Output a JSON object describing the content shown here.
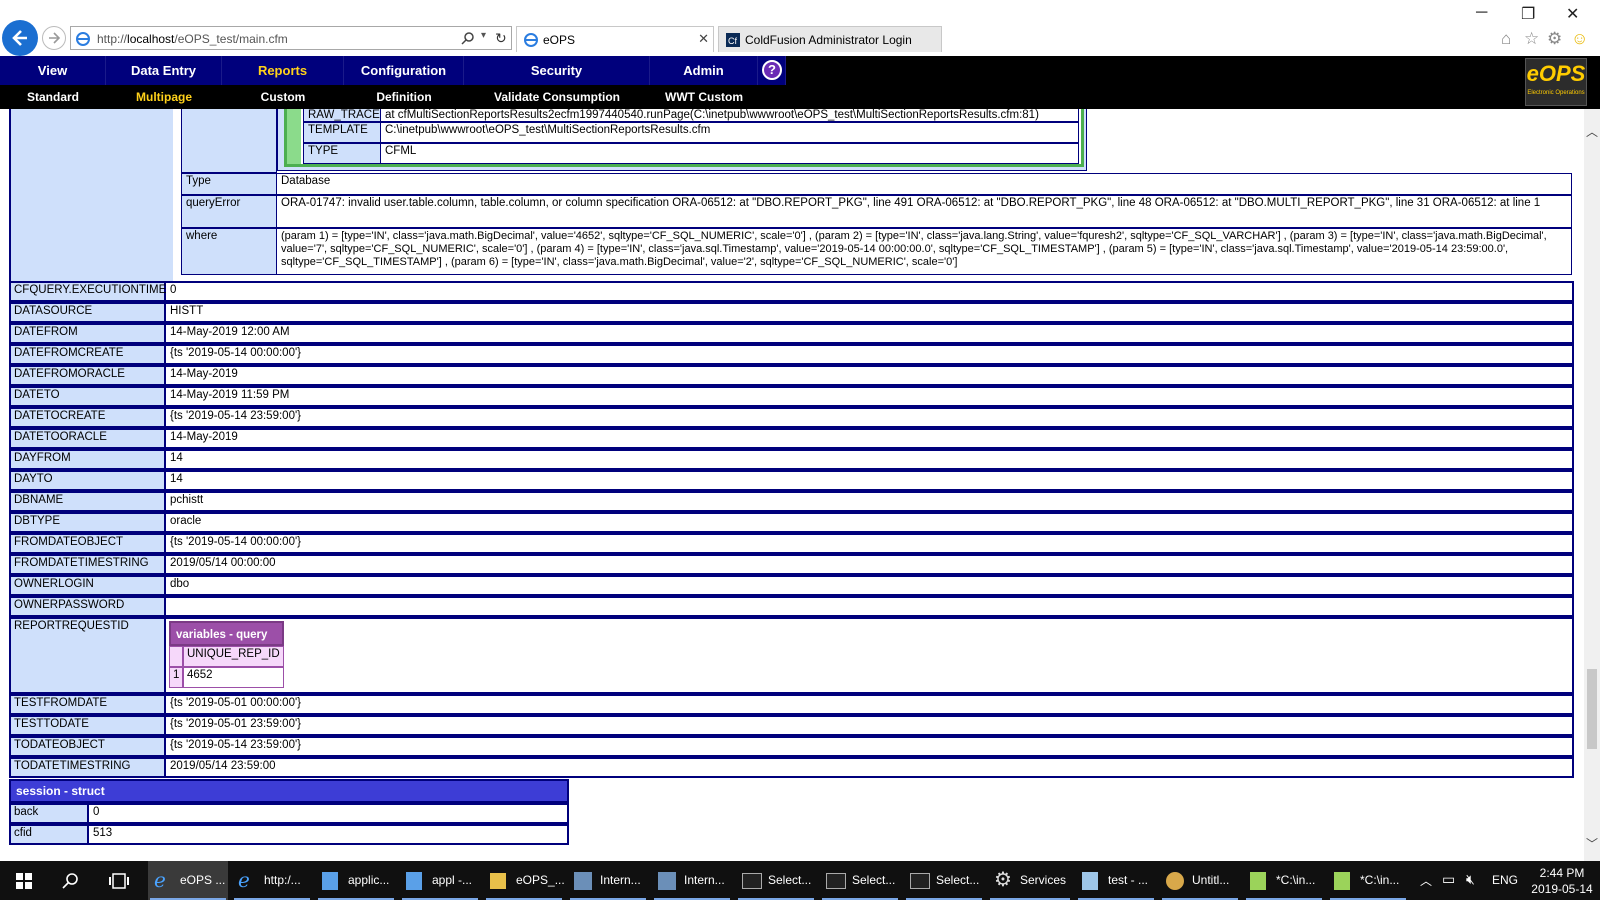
{
  "browser": {
    "url_prefix": "http://",
    "url_host": "localhost",
    "url_path": "/eOPS_test/main.cfm",
    "tabs": [
      {
        "label": "eOPS"
      },
      {
        "label": "ColdFusion Administrator Login"
      }
    ]
  },
  "nav": {
    "top": [
      "View",
      "Data Entry",
      "Reports",
      "Configuration",
      "Security",
      "Admin"
    ],
    "sub": [
      "Standard",
      "Multipage",
      "Custom",
      "Definition",
      "Validate Consumption",
      "WWT Custom"
    ],
    "help": "?",
    "logo": "eOPS",
    "logo_sub": "Electronic Operations"
  },
  "error": {
    "trace_rows": [
      {
        "key": "RAW_TRACE",
        "value": "at cfMultiSectionReportsResults2ecfm1997440540.runPage(C:\\inetpub\\wwwroot\\eOPS_test\\MultiSectionReportsResults.cfm:81)"
      },
      {
        "key": "TEMPLATE",
        "value": "C:\\inetpub\\wwwroot\\eOPS_test\\MultiSectionReportsResults.cfm"
      },
      {
        "key": "TYPE",
        "value": "CFML"
      }
    ],
    "type_key": "Type",
    "type_value": "Database",
    "queryerror_key": "queryError",
    "queryerror_value": "ORA-01747: invalid user.table.column, table.column, or column specification ORA-06512: at \"DBO.REPORT_PKG\", line 491 ORA-06512: at \"DBO.REPORT_PKG\", line 48 ORA-06512: at \"DBO.MULTI_REPORT_PKG\", line 31 ORA-06512: at line 1",
    "where_key": "where",
    "where_value": "(param 1) = [type='IN', class='java.math.BigDecimal', value='4652', sqltype='CF_SQL_NUMERIC', scale='0'] , (param 2) = [type='IN', class='java.lang.String', value='fquresh2', sqltype='CF_SQL_VARCHAR'] , (param 3) = [type='IN', class='java.math.BigDecimal', value='7', sqltype='CF_SQL_NUMERIC', scale='0'] , (param 4) = [type='IN', class='java.sql.Timestamp', value='2019-05-14 00:00:00.0', sqltype='CF_SQL_TIMESTAMP'] , (param 5) = [type='IN', class='java.sql.Timestamp', value='2019-05-14 23:59:00.0', sqltype='CF_SQL_TIMESTAMP'] , (param 6) = [type='IN', class='java.math.BigDecimal', value='2', sqltype='CF_SQL_NUMERIC', scale='0']"
  },
  "vars": [
    {
      "key": "CFQUERY.EXECUTIONTIME",
      "value": "0"
    },
    {
      "key": "DATASOURCE",
      "value": "HISTT"
    },
    {
      "key": "DATEFROM",
      "value": "14-May-2019 12:00 AM"
    },
    {
      "key": "DATEFROMCREATE",
      "value": "{ts '2019-05-14 00:00:00'}"
    },
    {
      "key": "DATEFROMORACLE",
      "value": "14-May-2019"
    },
    {
      "key": "DATETO",
      "value": "14-May-2019 11:59 PM"
    },
    {
      "key": "DATETOCREATE",
      "value": "{ts '2019-05-14 23:59:00'}"
    },
    {
      "key": "DATETOORACLE",
      "value": "14-May-2019"
    },
    {
      "key": "DAYFROM",
      "value": "14"
    },
    {
      "key": "DAYTO",
      "value": "14"
    },
    {
      "key": "DBNAME",
      "value": "pchistt"
    },
    {
      "key": "DBTYPE",
      "value": "oracle"
    },
    {
      "key": "FROMDATEOBJECT",
      "value": "{ts '2019-05-14 00:00:00'}"
    },
    {
      "key": "FROMDATETIMESTRING",
      "value": "2019/05/14 00:00:00"
    },
    {
      "key": "OWNERLOGIN",
      "value": "dbo"
    },
    {
      "key": "OWNERPASSWORD",
      "value": ""
    }
  ],
  "reportrequest": {
    "key": "REPORTREQUESTID",
    "query_title": "variables - query",
    "column": "UNIQUE_REP_ID",
    "row_index": "1",
    "row_value": "4652"
  },
  "vars2": [
    {
      "key": "TESTFROMDATE",
      "value": "{ts '2019-05-01 00:00:00'}"
    },
    {
      "key": "TESTTODATE",
      "value": "{ts '2019-05-01 23:59:00'}"
    },
    {
      "key": "TODATEOBJECT",
      "value": "{ts '2019-05-14 23:59:00'}"
    },
    {
      "key": "TODATETIMESTRING",
      "value": "2019/05/14 23:59:00"
    }
  ],
  "session": {
    "title": "session - struct",
    "rows": [
      {
        "key": "back",
        "value": "0"
      },
      {
        "key": "cfid",
        "value": "513"
      }
    ]
  },
  "taskbar": {
    "items": [
      {
        "label": "eOPS ..."
      },
      {
        "label": "http:/..."
      },
      {
        "label": "applic..."
      },
      {
        "label": "appl -..."
      },
      {
        "label": "eOPS_..."
      },
      {
        "label": "Intern..."
      },
      {
        "label": "Intern..."
      },
      {
        "label": "Select..."
      },
      {
        "label": "Select..."
      },
      {
        "label": "Select..."
      },
      {
        "label": "Services"
      },
      {
        "label": "test - ..."
      },
      {
        "label": "Untitl..."
      },
      {
        "label": "*C:\\in..."
      },
      {
        "label": "*C:\\in..."
      }
    ],
    "lang": "ENG",
    "time": "2:44 PM",
    "date": "2019-05-14"
  },
  "colors": {
    "nav_bg": "#00007c",
    "active_nav": "#ffd11a",
    "key_bg": "#cfe0fb",
    "border": "#00007c",
    "query_header": "#9c4fa8",
    "session_header": "#3d3dd6"
  }
}
